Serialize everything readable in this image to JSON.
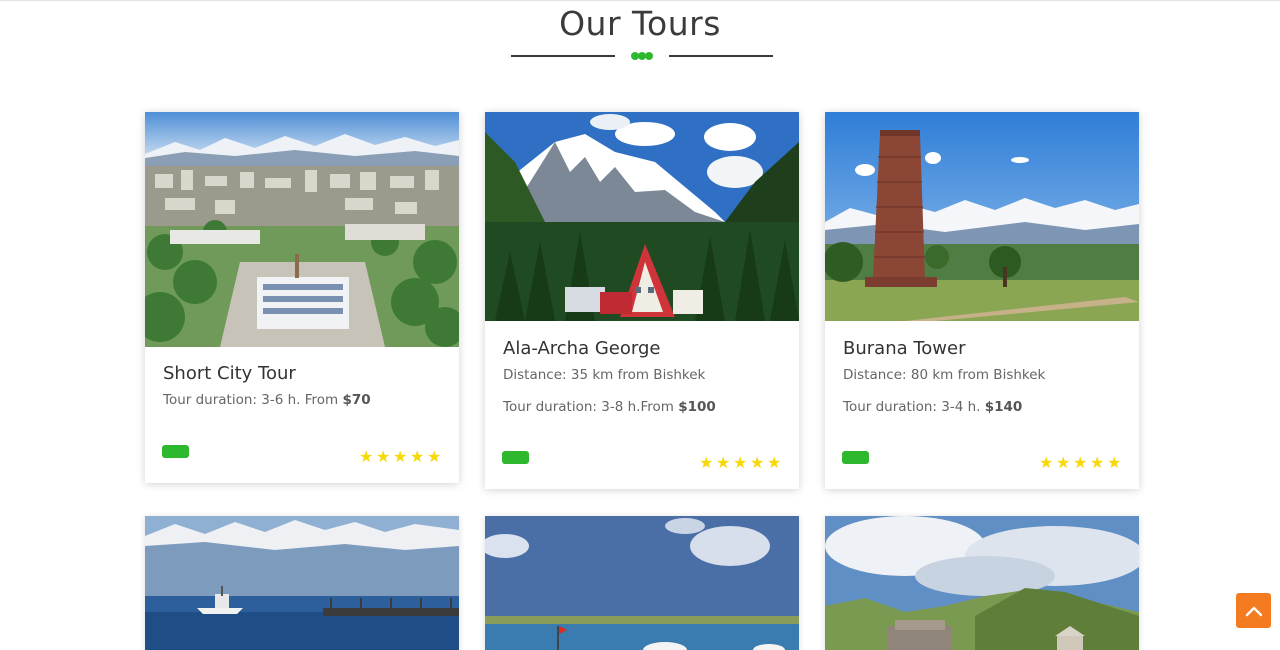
{
  "section": {
    "title": "Our Tours"
  },
  "tours": [
    {
      "title": "Short City Tour",
      "lines": [
        {
          "text": "Tour duration: 3-6 h. From ",
          "bold": "$70"
        }
      ],
      "rating": 5
    },
    {
      "title": "Ala-Archa George",
      "lines": [
        {
          "text": "Distance: 35 km from Bishkek",
          "bold": ""
        },
        {
          "text": "Tour duration: 3-8 h.From ",
          "bold": "$100"
        }
      ],
      "rating": 5
    },
    {
      "title": "Burana Tower",
      "lines": [
        {
          "text": "Distance: 80 km from Bishkek",
          "bold": ""
        },
        {
          "text": "Tour duration: 3-4 h. ",
          "bold": "$140"
        }
      ],
      "rating": 5
    }
  ],
  "icons": {
    "divider": "dots-divider-icon",
    "star": "star-icon",
    "scroll_top": "chevron-up-icon"
  },
  "colors": {
    "accent_green": "#2eb82e",
    "star_yellow": "#f5d90a",
    "scroll_button": "#f47b20"
  }
}
